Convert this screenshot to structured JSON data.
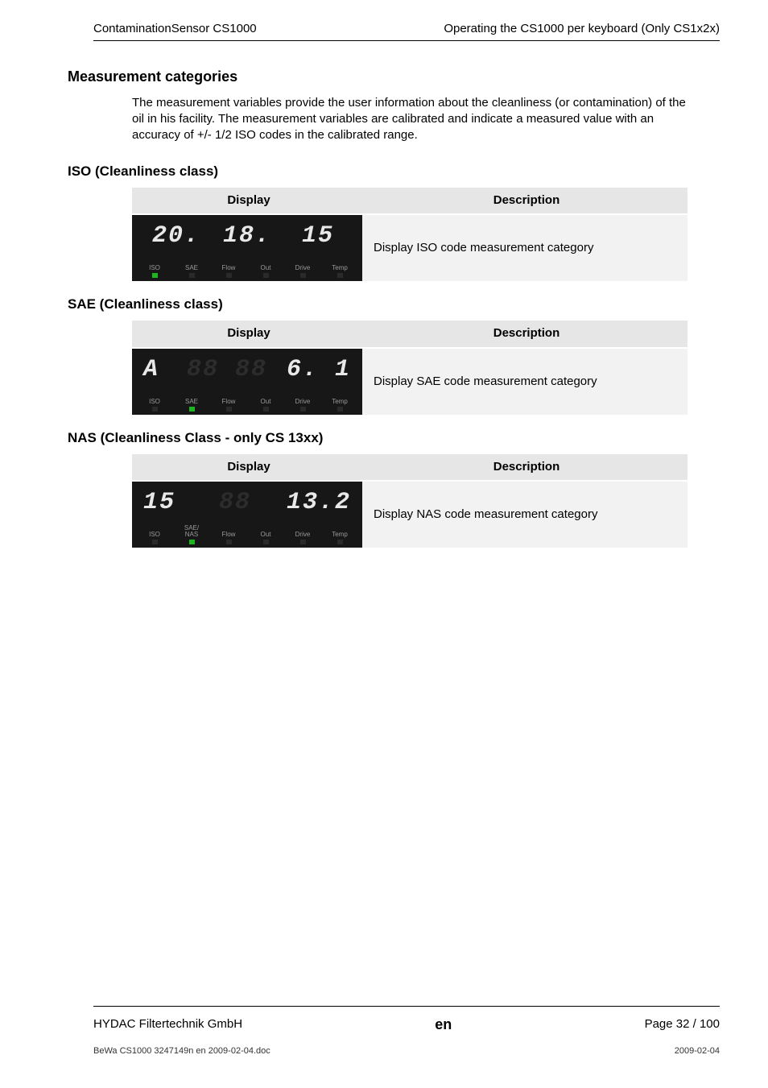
{
  "header": {
    "left": "ContaminationSensor CS1000",
    "right": "Operating the CS1000 per keyboard (Only CS1x2x)"
  },
  "section_title": "Measurement categories",
  "body_text": "The measurement variables provide the user information about the cleanliness (or contamination) of the oil in his facility.  The measurement variables are calibrated and indicate a measured value with an accuracy of +/- 1/2 ISO codes in the calibrated range.",
  "iso": {
    "heading": "ISO (Cleanliness class)",
    "col_display": "Display",
    "col_desc": "Description",
    "desc": "Display ISO code measurement category",
    "seg": [
      "20.",
      "18.",
      "15"
    ],
    "labels": [
      "ISO",
      "SAE",
      "Flow",
      "Out",
      "Drive",
      "Temp"
    ],
    "on_index": 0
  },
  "sae": {
    "heading": "SAE (Cleanliness class)",
    "col_display": "Display",
    "col_desc": "Description",
    "desc": "Display SAE code measurement category",
    "seg_left": "A",
    "seg_right": "6. 1",
    "labels": [
      "ISO",
      "SAE",
      "Flow",
      "Out",
      "Drive",
      "Temp"
    ],
    "on_index": 1
  },
  "nas": {
    "heading": "NAS (Cleanliness Class - only CS 13xx)",
    "col_display": "Display",
    "col_desc": "Description",
    "desc": "Display NAS code measurement category",
    "seg_left": "15",
    "seg_right": "13.2",
    "labels": [
      "ISO",
      "SAE/\nNAS",
      "Flow",
      "Out",
      "Drive",
      "Temp"
    ],
    "on_index": 1
  },
  "footer": {
    "company": "HYDAC Filtertechnik GmbH",
    "lang": "en",
    "page": "Page 32 / 100",
    "doc": "BeWa CS1000 3247149n en 2009-02-04.doc",
    "date": "2009-02-04"
  }
}
